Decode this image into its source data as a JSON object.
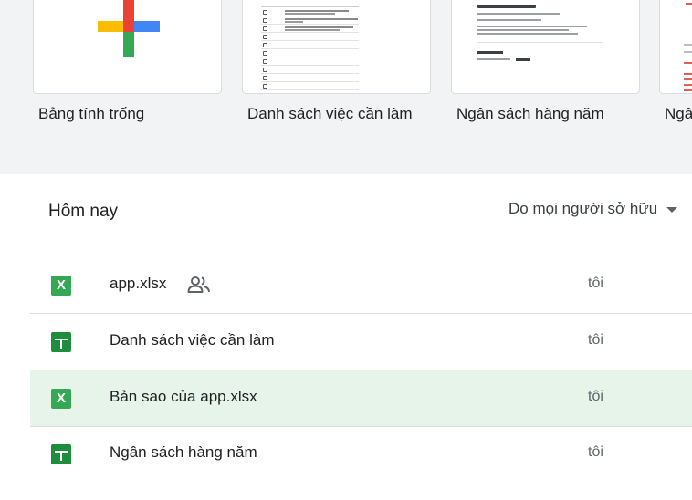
{
  "templates": [
    {
      "label": "Bảng tính trống",
      "icon": "plus-icon"
    },
    {
      "label": "Danh sách việc cần làm",
      "icon": "todo-thumbnail"
    },
    {
      "label": "Ngân sách hàng năm",
      "icon": "budget-thumbnail"
    },
    {
      "label": "Ngâ",
      "icon": "template-thumbnail"
    }
  ],
  "recent": {
    "title": "Hôm nay",
    "owner_filter": "Do mọi người sở hữu",
    "files": [
      {
        "name": "app.xlsx",
        "owner": "tôi",
        "type": "excel",
        "shared": true,
        "selected": false
      },
      {
        "name": "Danh sách việc cần làm",
        "owner": "tôi",
        "type": "sheets",
        "shared": false,
        "selected": false
      },
      {
        "name": "Bản sao của app.xlsx",
        "owner": "tôi",
        "type": "excel",
        "shared": false,
        "selected": true
      },
      {
        "name": "Ngân sách hàng năm",
        "owner": "tôi",
        "type": "sheets",
        "shared": false,
        "selected": false
      }
    ]
  },
  "icons": {
    "excel_glyph": "X"
  },
  "colors": {
    "gallery_bg": "#f1f3f4",
    "selected_row": "#e6f4ea",
    "sheets_green": "#1e8e3e",
    "excel_green": "#34a853",
    "plus_red": "#ea4335",
    "plus_blue": "#4285f4",
    "plus_green": "#34a853",
    "plus_yellow": "#fbbc04"
  }
}
